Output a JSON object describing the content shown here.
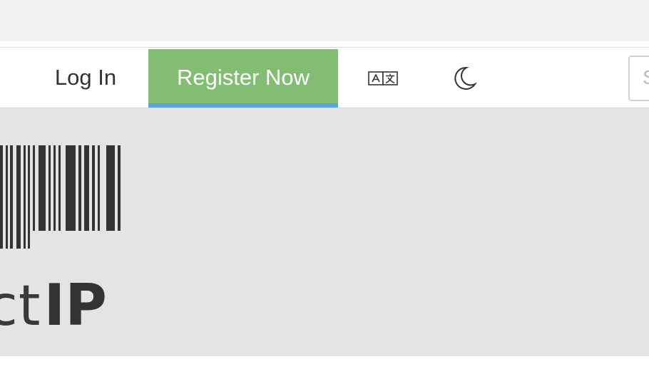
{
  "nav": {
    "login_label": "Log In",
    "register_label": "Register Now",
    "language_icon": "translate-icon",
    "theme_icon": "moon-icon",
    "search_placeholder": "S"
  },
  "logo": {
    "text_light": "ct",
    "text_bold": "IP"
  },
  "colors": {
    "register_bg": "#83bd73",
    "register_underline": "#5aa6d6",
    "hero_bg": "#e4e4e4",
    "logo": "#333333"
  }
}
